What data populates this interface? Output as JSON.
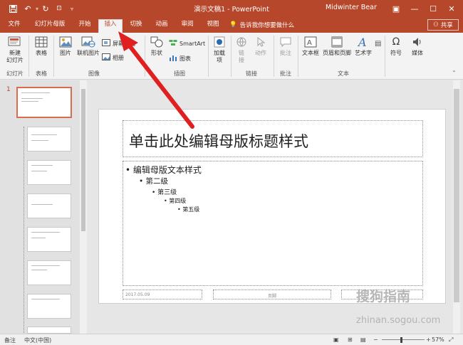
{
  "titlebar": {
    "doc_title": "演示文稿1  -  PowerPoint",
    "user": "Midwinter Bear",
    "save_icon": "save-icon",
    "accent": "#b7472a"
  },
  "tabs": [
    {
      "label": "文件"
    },
    {
      "label": "幻灯片母版"
    },
    {
      "label": "开始"
    },
    {
      "label": "插入"
    },
    {
      "label": "切换"
    },
    {
      "label": "动画"
    },
    {
      "label": "审阅"
    },
    {
      "label": "视图"
    }
  ],
  "tellme": "告诉我你想要做什么",
  "share": "共享",
  "ribbon": {
    "new_slide": "新建\n幻灯片",
    "table": "表格",
    "picture": "图片",
    "online_picture": "联机图片",
    "screenshot": "屏幕截图",
    "album": "相册",
    "shapes": "形状",
    "smartart": "SmartArt",
    "chart": "图表",
    "addins": "加载\n项",
    "link": "链\n接",
    "action": "动作",
    "comment": "批注",
    "textbox": "文本框",
    "header_footer": "页眉和页脚",
    "wordart": "艺术字",
    "symbol": "符号",
    "media": "媒体",
    "groups": {
      "slides": "幻灯片",
      "tables": "表格",
      "images": "图像",
      "illustrations": "插图",
      "links": "链接",
      "comments": "批注",
      "text": "文本"
    }
  },
  "thumbs": {
    "slide_number": "1"
  },
  "slide": {
    "title": "单击此处编辑母版标题样式",
    "level1": "编辑母版文本样式",
    "level2": "第二级",
    "level3": "第三级",
    "level4": "第四级",
    "level5": "第五级",
    "date": "2017.05.09",
    "footer": "页脚"
  },
  "status": {
    "left": "备注",
    "lang": "中文(中国)",
    "zoom": "57%"
  },
  "watermark": {
    "brand": "搜狗指南",
    "url": "zhinan.sogou.com"
  }
}
